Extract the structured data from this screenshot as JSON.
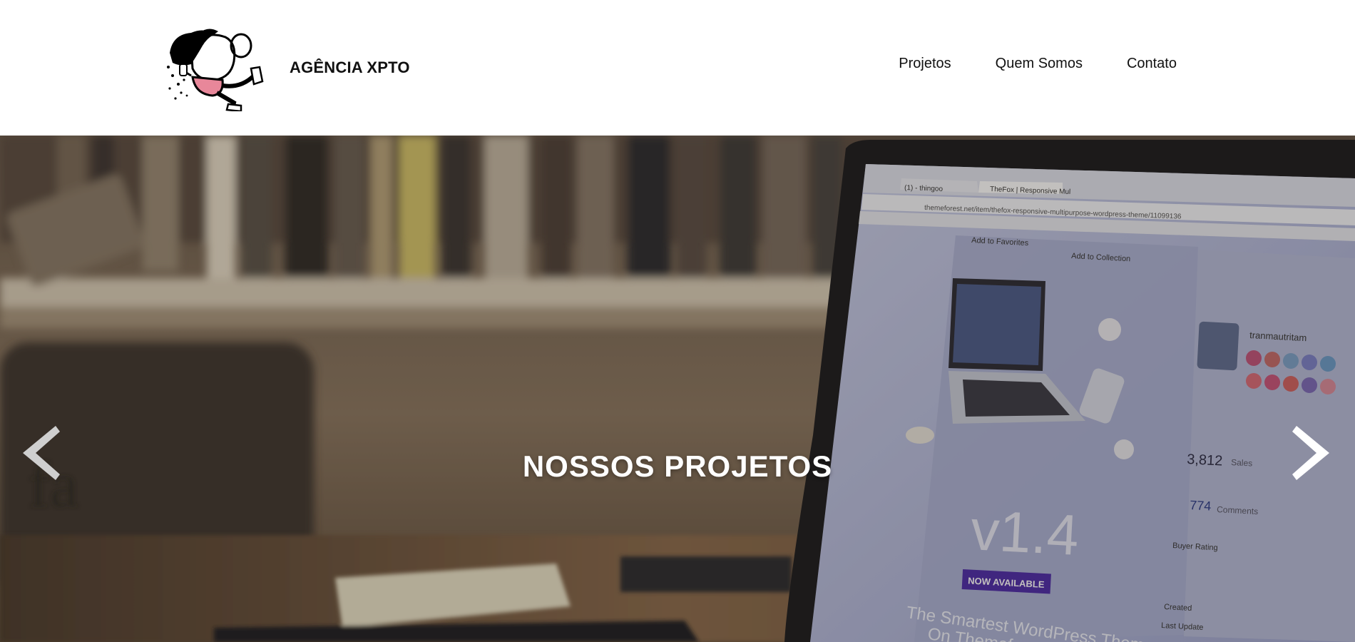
{
  "header": {
    "brand_name": "AGÊNCIA XPTO",
    "logo_icon": "mascot-logo-icon",
    "nav": [
      {
        "label": "Projetos"
      },
      {
        "label": "Quem Somos"
      },
      {
        "label": "Contato"
      }
    ]
  },
  "hero": {
    "title": "NOSSOS PROJETOS",
    "prev_icon": "chevron-left-icon",
    "next_icon": "chevron-right-icon",
    "laptop_screen": {
      "address": "themeforest.net/item/thefox-responsive-multipurpose-wordpress-theme/11099136",
      "tab1": "(1) - thingoo",
      "tab2": "TheFox | Responsive Mul",
      "add_favorites": "Add to Favorites",
      "add_collection": "Add to Collection",
      "author": "tranmautritam",
      "sales": "3,812",
      "sales_label": "Sales",
      "comments": "774",
      "comments_label": "Comments",
      "buyer_rating": "Buyer Rating",
      "created": "Created",
      "last_update": "Last Update",
      "version": "v1.4",
      "now_available": "NOW AVAILABLE",
      "tagline": "The Smartest WordPress Theme On Themeforest"
    }
  },
  "colors": {
    "brand_text": "#111111",
    "hero_title": "#ffffff",
    "header_bg": "#ffffff",
    "badge_purple": "#4b2aa8"
  }
}
